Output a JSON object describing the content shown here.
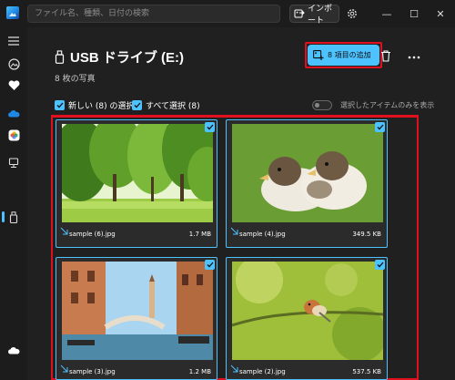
{
  "titlebar": {
    "search_placeholder": "ファイル名、種類、日付の検索",
    "import_label": "インポート",
    "minimize": "—",
    "maximize": "☐",
    "close": "✕"
  },
  "header": {
    "title": "USB ドライブ (E:)",
    "subtitle": "8 枚の写真",
    "add_button_label": "8 項目の追加"
  },
  "selection": {
    "new_select_label": "新しい (8) の選択",
    "select_all_label": "すべて選択 (8)",
    "show_selected_label": "選択したアイテムのみを表示"
  },
  "photos": [
    {
      "name": "sample (6).jpg",
      "size": "1.7 MB"
    },
    {
      "name": "sample (4).jpg",
      "size": "349.5 KB"
    },
    {
      "name": "sample (3).jpg",
      "size": "1.2 MB"
    },
    {
      "name": "sample (2).jpg",
      "size": "537.5 KB"
    }
  ],
  "colors": {
    "accent": "#4cc2ff",
    "highlight_frame": "#e0101e",
    "background": "#202020"
  }
}
